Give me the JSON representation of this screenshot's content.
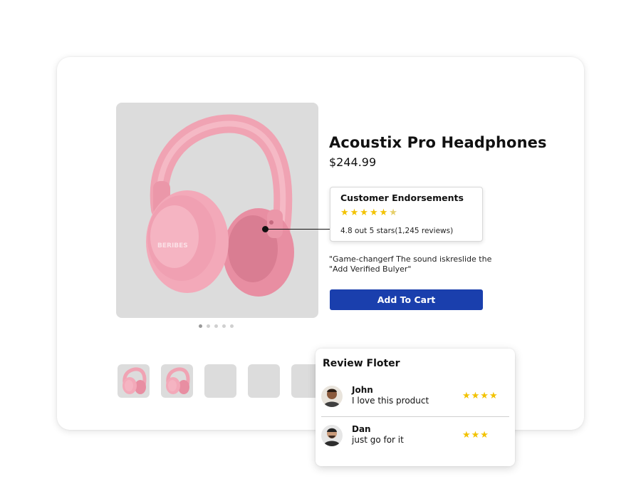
{
  "product": {
    "title": "Acoustix Pro Headphones",
    "price": "$244.99",
    "brand_label": "BERIBES",
    "image_icon": "pink-headphones-image",
    "gallery_dots": 5,
    "gallery_active_dot": 1
  },
  "endorsements": {
    "title": "Customer Endorsements",
    "stars_full": "★★★★★",
    "stars_partial": "★",
    "rating_text": "4.8 out 5 stars(1,245 reviews)"
  },
  "quote": "\"Game-changerf The sound iskreslide the \"Add Verified Bulyer\"",
  "cart_button": "Add To Cart",
  "thumbnails": [
    {
      "kind": "headphones"
    },
    {
      "kind": "headphones"
    },
    {
      "kind": "empty"
    },
    {
      "kind": "empty"
    },
    {
      "kind": "empty"
    }
  ],
  "review_panel": {
    "title": "Review Floter",
    "reviews": [
      {
        "name": "John",
        "text": "I love this product",
        "stars": "★★★★"
      },
      {
        "name": "Dan",
        "text": "just go for it",
        "stars": "★★★"
      }
    ]
  },
  "colors": {
    "accent": "#1a3fad",
    "star": "#f2c200",
    "product_pink": "#f2a7b6"
  }
}
